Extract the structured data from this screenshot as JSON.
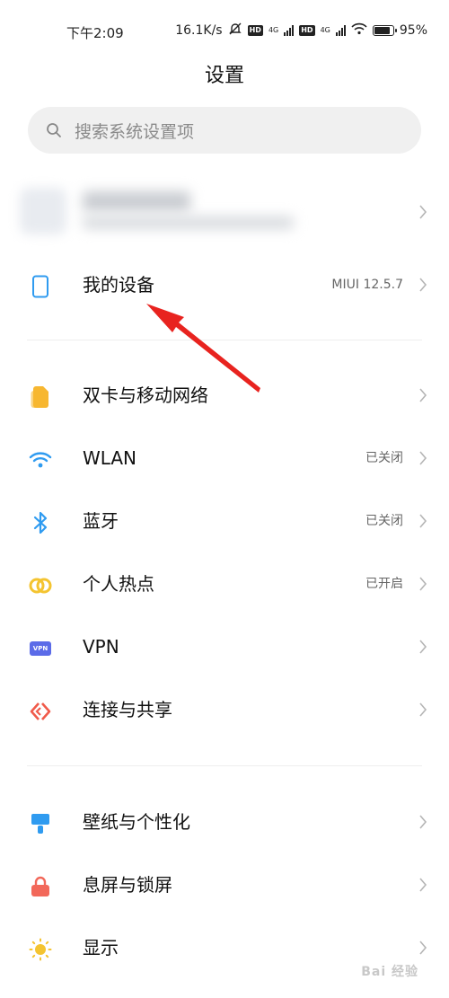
{
  "status_bar": {
    "time": "下午2:09",
    "speed": "16.1K/s",
    "battery": "95%",
    "battery_level": 0.95,
    "net1": "4G",
    "net2": "4G",
    "hd": "HD"
  },
  "page": {
    "title": "设置"
  },
  "search": {
    "placeholder": "搜索系统设置项"
  },
  "rows": [
    {
      "label": "我的设备",
      "value": "MIUI 12.5.7",
      "icon": "phone-icon"
    },
    {
      "label": "双卡与移动网络",
      "value": "",
      "icon": "sim-card-icon"
    },
    {
      "label": "WLAN",
      "value": "已关闭",
      "icon": "wifi-icon"
    },
    {
      "label": "蓝牙",
      "value": "已关闭",
      "icon": "bluetooth-icon"
    },
    {
      "label": "个人热点",
      "value": "已开启",
      "icon": "hotspot-icon"
    },
    {
      "label": "VPN",
      "value": "",
      "icon": "vpn-icon",
      "badge": "VPN"
    },
    {
      "label": "连接与共享",
      "value": "",
      "icon": "connection-share-icon"
    },
    {
      "label": "壁纸与个性化",
      "value": "",
      "icon": "wallpaper-icon"
    },
    {
      "label": "息屏与锁屏",
      "value": "",
      "icon": "lock-icon"
    },
    {
      "label": "显示",
      "value": "",
      "icon": "sun-icon"
    }
  ],
  "colors": {
    "accent_blue": "#2f9bf0",
    "sim_yellow": "#f7b731",
    "hotspot_yellow": "#f4c430",
    "vpn_purple": "#5b6be8",
    "share_red": "#f05a4a",
    "lock_red": "#f2685a",
    "annotation_red": "#e8231f"
  },
  "watermark": "Bai 经验"
}
